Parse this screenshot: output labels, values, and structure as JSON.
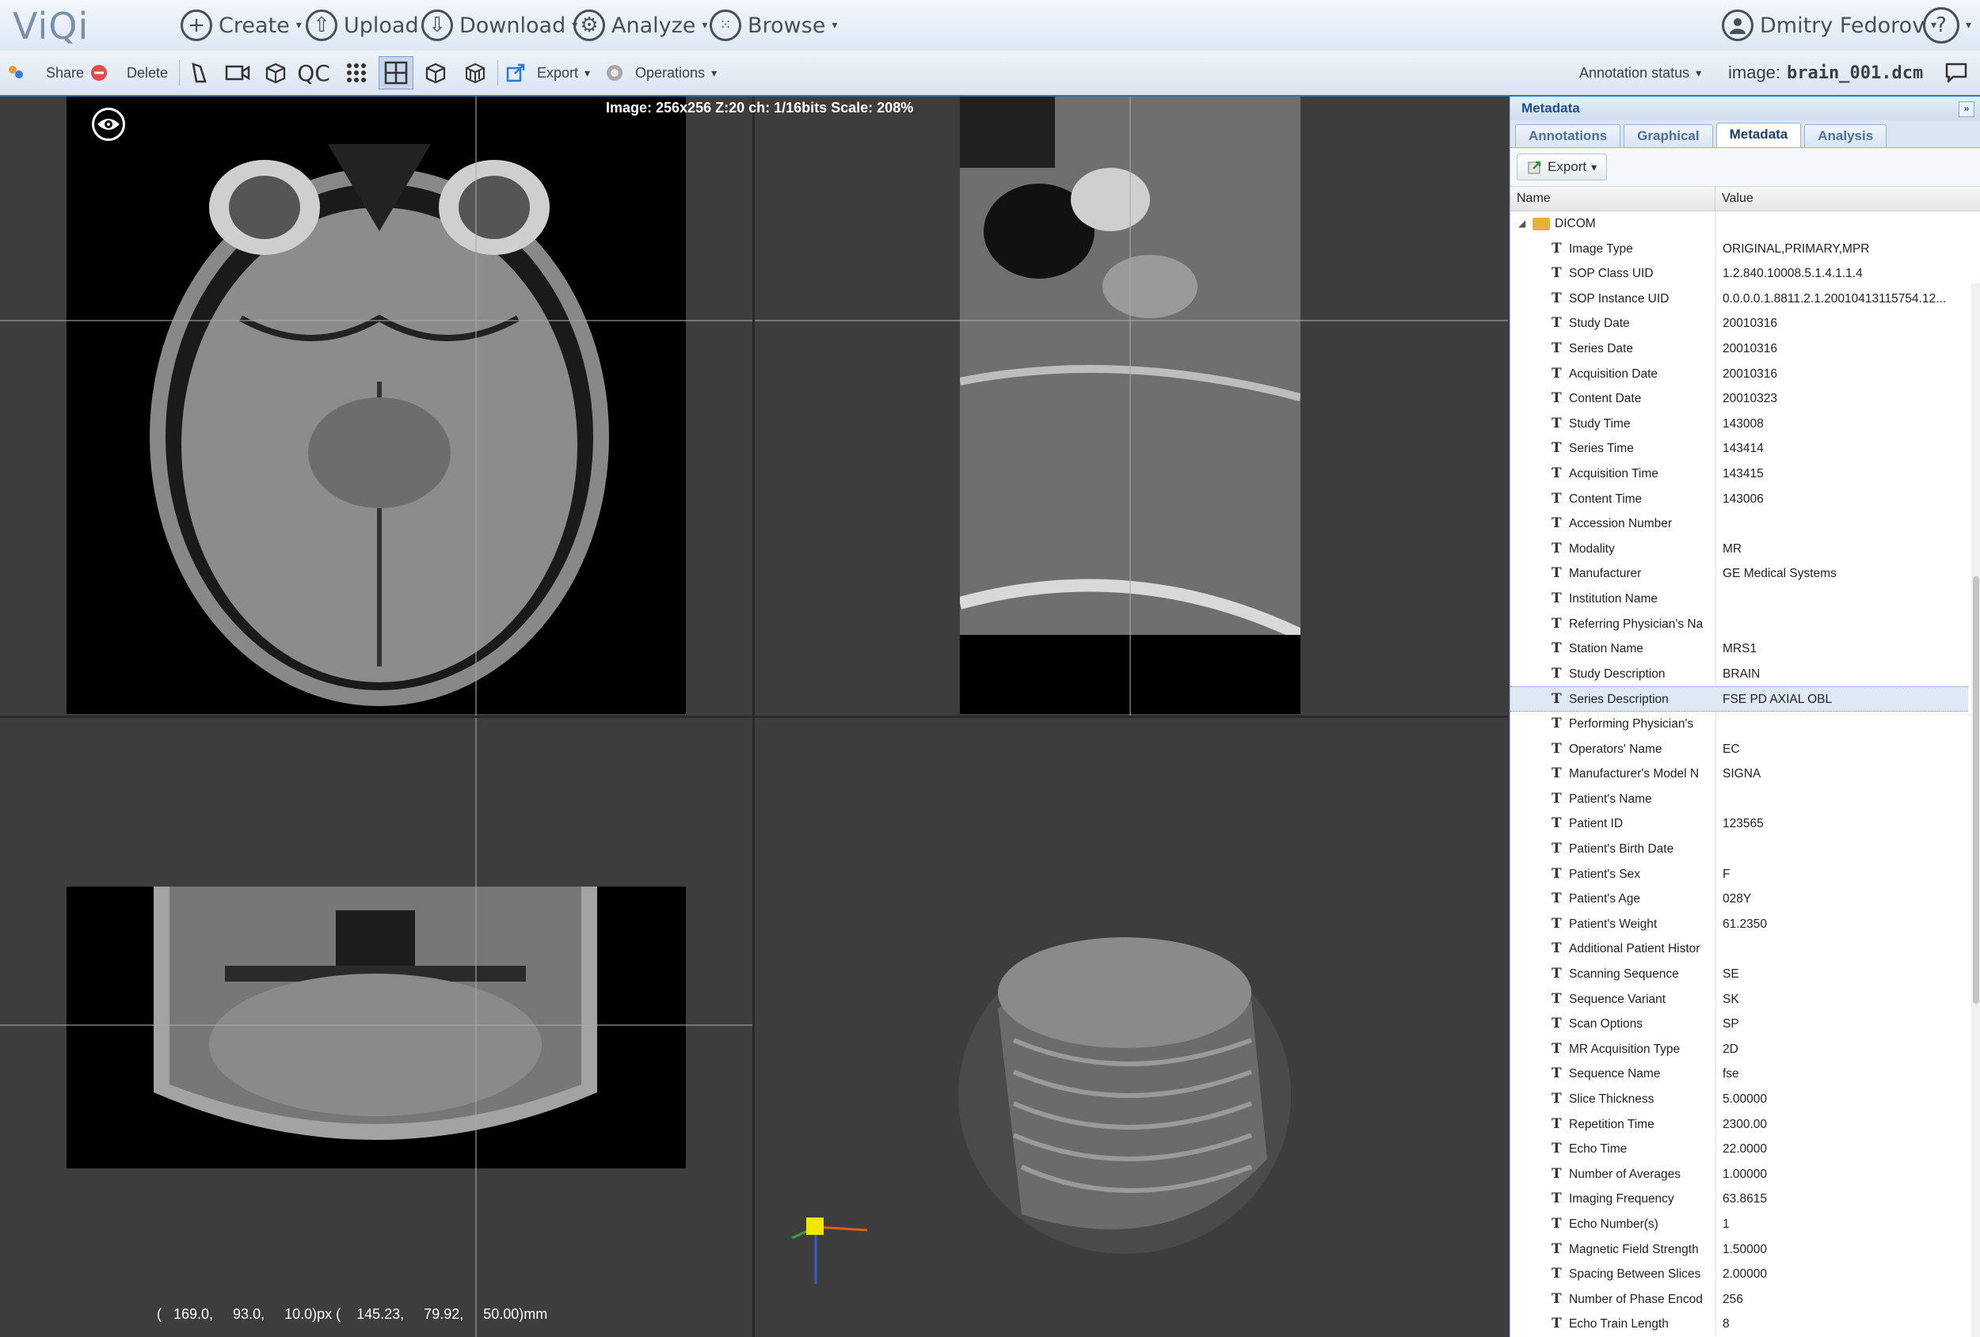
{
  "app": {
    "logo": "ViQi"
  },
  "menu": {
    "create": "Create",
    "upload": "Upload",
    "download": "Download",
    "analyze": "Analyze",
    "browse": "Browse",
    "user": "Dmitry Fedorov",
    "help": "?"
  },
  "toolbar": {
    "share": "Share",
    "delete": "Delete",
    "qc": "QC",
    "export": "Export",
    "operations": "Operations",
    "annotation_status": "Annotation status",
    "image_label": "image:",
    "image_name": "brain_001.dcm"
  },
  "viewer": {
    "status_text": "Image: 256x256 Z:20 ch: 1/16bits Scale: 208%",
    "coords_text": "(   169.0,     93.0,     10.0)px (    145.23,     79.92,     50.00)mm"
  },
  "panel": {
    "title": "Metadata",
    "collapse": "»",
    "tabs": [
      "Annotations",
      "Graphical",
      "Metadata",
      "Analysis"
    ],
    "active_tab": "Metadata",
    "export_button": "Export",
    "columns": [
      "Name",
      "Value"
    ],
    "root": "DICOM",
    "selected_row": "Series Description",
    "rows": [
      {
        "name": "Image Type",
        "value": "ORIGINAL,PRIMARY,MPR"
      },
      {
        "name": "SOP Class UID",
        "value": "1.2.840.10008.5.1.4.1.1.4"
      },
      {
        "name": "SOP Instance UID",
        "value": "0.0.0.0.1.8811.2.1.20010413115754.12..."
      },
      {
        "name": "Study Date",
        "value": "20010316"
      },
      {
        "name": "Series Date",
        "value": "20010316"
      },
      {
        "name": "Acquisition Date",
        "value": "20010316"
      },
      {
        "name": "Content Date",
        "value": "20010323"
      },
      {
        "name": "Study Time",
        "value": "143008"
      },
      {
        "name": "Series Time",
        "value": "143414"
      },
      {
        "name": "Acquisition Time",
        "value": "143415"
      },
      {
        "name": "Content Time",
        "value": "143006"
      },
      {
        "name": "Accession Number",
        "value": ""
      },
      {
        "name": "Modality",
        "value": "MR"
      },
      {
        "name": "Manufacturer",
        "value": "GE Medical Systems"
      },
      {
        "name": "Institution Name",
        "value": ""
      },
      {
        "name": "Referring Physician's Na",
        "value": ""
      },
      {
        "name": "Station Name",
        "value": "MRS1"
      },
      {
        "name": "Study Description",
        "value": "BRAIN"
      },
      {
        "name": "Series Description",
        "value": "FSE PD AXIAL OBL"
      },
      {
        "name": "Performing Physician's",
        "value": ""
      },
      {
        "name": "Operators' Name",
        "value": "EC"
      },
      {
        "name": "Manufacturer's Model N",
        "value": "SIGNA"
      },
      {
        "name": "Patient's Name",
        "value": ""
      },
      {
        "name": "Patient ID",
        "value": "123565"
      },
      {
        "name": "Patient's Birth Date",
        "value": ""
      },
      {
        "name": "Patient's Sex",
        "value": "F"
      },
      {
        "name": "Patient's Age",
        "value": "028Y"
      },
      {
        "name": "Patient's Weight",
        "value": "61.2350"
      },
      {
        "name": "Additional Patient Histor",
        "value": ""
      },
      {
        "name": "Scanning Sequence",
        "value": "SE"
      },
      {
        "name": "Sequence Variant",
        "value": "SK"
      },
      {
        "name": "Scan Options",
        "value": "SP"
      },
      {
        "name": "MR Acquisition Type",
        "value": "2D"
      },
      {
        "name": "Sequence Name",
        "value": "fse"
      },
      {
        "name": "Slice Thickness",
        "value": "5.00000"
      },
      {
        "name": "Repetition Time",
        "value": "2300.00"
      },
      {
        "name": "Echo Time",
        "value": "22.0000"
      },
      {
        "name": "Number of Averages",
        "value": "1.00000"
      },
      {
        "name": "Imaging Frequency",
        "value": "63.8615"
      },
      {
        "name": "Echo Number(s)",
        "value": "1"
      },
      {
        "name": "Magnetic Field Strength",
        "value": "1.50000"
      },
      {
        "name": "Spacing Between Slices",
        "value": "2.00000"
      },
      {
        "name": "Number of Phase Encod",
        "value": "256"
      },
      {
        "name": "Echo Train Length",
        "value": "8"
      }
    ]
  },
  "colors": {
    "accent": "#1e4e8c",
    "folder": "#e8b13f",
    "axis_x": "#e35d1a",
    "axis_y": "#3aa13a",
    "axis_z": "#2b5fd0",
    "cube": "#f2e600"
  },
  "icons": [
    "plus-icon",
    "upload-icon",
    "download-icon",
    "gear-icon",
    "grid-icon",
    "user-icon",
    "help-icon",
    "share-icon",
    "delete-icon",
    "eye-icon",
    "folder-icon",
    "chat-icon"
  ]
}
